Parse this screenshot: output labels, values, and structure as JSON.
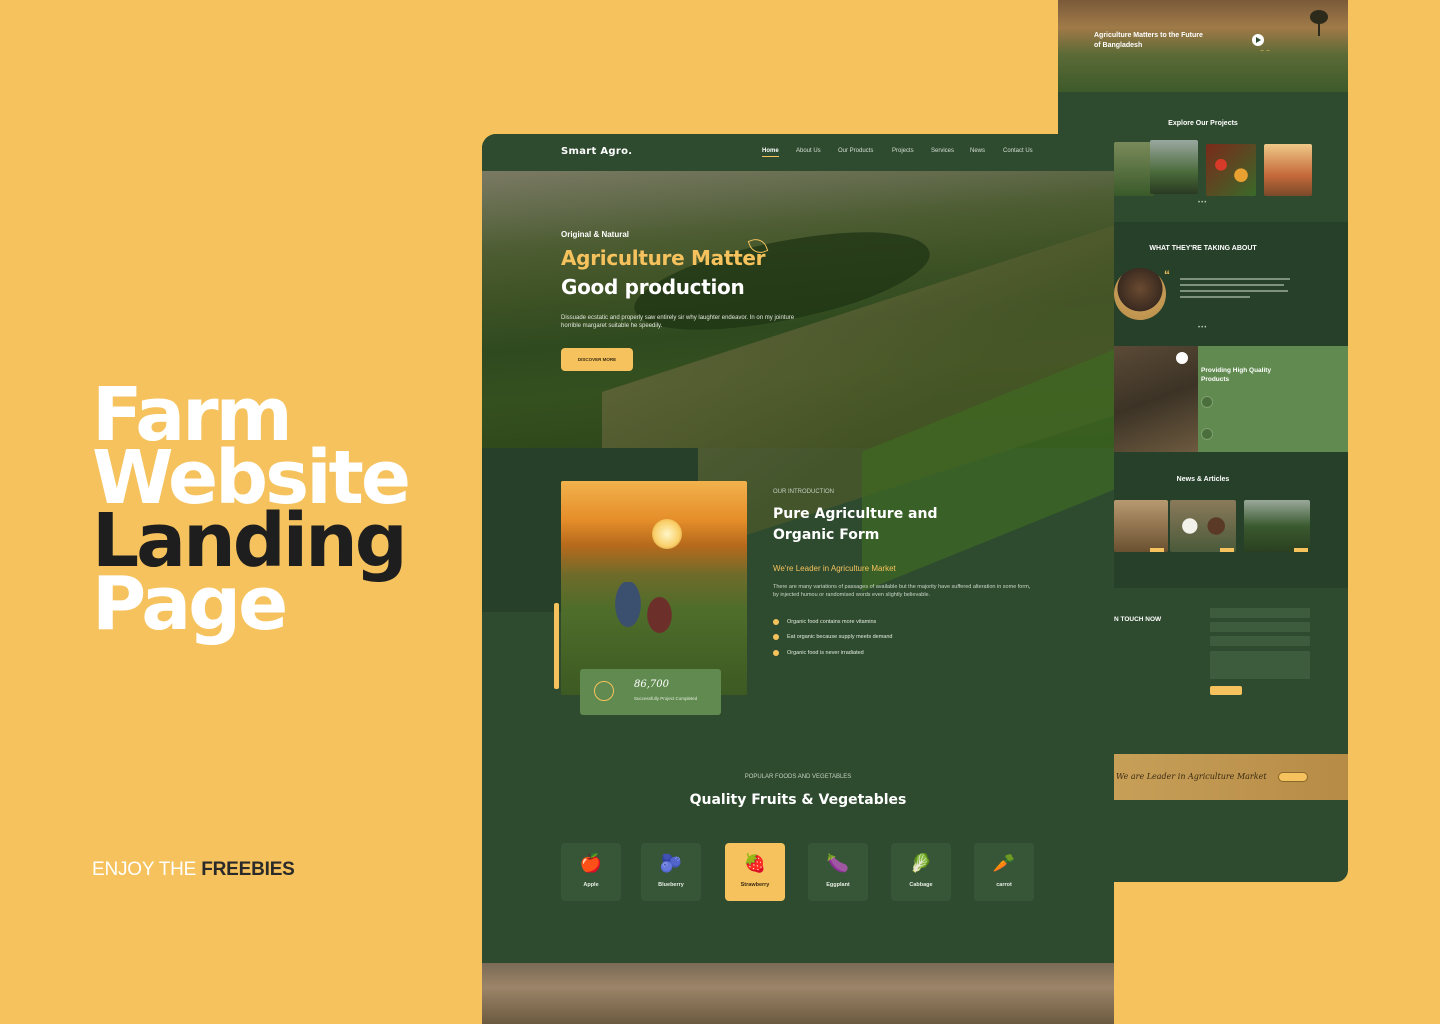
{
  "promo": {
    "title_lines": [
      "Farm",
      "Website",
      "Landing",
      "Page"
    ],
    "sub_prefix": "ENJOY THE ",
    "sub_bold": "FREEBIES"
  },
  "nav": {
    "logo": "Smart Agro.",
    "items": [
      "Home",
      "About Us",
      "Our Products",
      "Projects",
      "Services",
      "News",
      "Contact Us"
    ]
  },
  "hero": {
    "kicker": "Original & Natural",
    "title_line1": "Agriculture Matter",
    "title_line2": "Good production",
    "text": "Dissuade ecstatic and properly saw entirely sir why laughter endeavor. In on my jointure horrible margaret suitable he speedily.",
    "button": "DISCOVER MORE"
  },
  "intro": {
    "kicker": "OUR INTRODUCTION",
    "title": "Pure Agriculture and Organic Form",
    "lead": "We're Leader in Agriculture Market",
    "text": "There are many variations of passages of available but the majority have suffered alteration in some form, by injected humou or randomised words even slightly believable.",
    "checks": [
      "Organic food contains more vitamins",
      "Eat organic because supply meets demand",
      "Organic food is never irradiated"
    ],
    "stat_number": "86,700",
    "stat_label": "Successfully Project Completed"
  },
  "foods": {
    "kicker": "POPULAR FOODS AND VEGETABLES",
    "title": "Quality Fruits & Vegetables",
    "items": [
      {
        "name": "Apple",
        "icon": "🍎"
      },
      {
        "name": "Blueberry",
        "icon": "🫐"
      },
      {
        "name": "Strawberry",
        "icon": "🍓"
      },
      {
        "name": "Eggplant",
        "icon": "🍆"
      },
      {
        "name": "Cabbage",
        "icon": "🥬"
      },
      {
        "name": "carrot",
        "icon": "🥕"
      }
    ],
    "active_item": "Strawberry"
  },
  "back": {
    "hero_text": "Agriculture Matters to the Future of Bangladesh",
    "projects_title": "Explore Our Projects",
    "testimonial_title": "WHAT THEY'RE TAKING ABOUT",
    "quality_title": "Providing High Quality Products",
    "news_title": "News & Articles",
    "contact_title": "N TOUCH NOW",
    "banner_text": "We are Leader in Agriculture Market"
  },
  "colors": {
    "background": "#F5C25D",
    "dark_green": "#2E4B2F",
    "accent": "#F5C25D",
    "card_green": "#608A4F"
  }
}
